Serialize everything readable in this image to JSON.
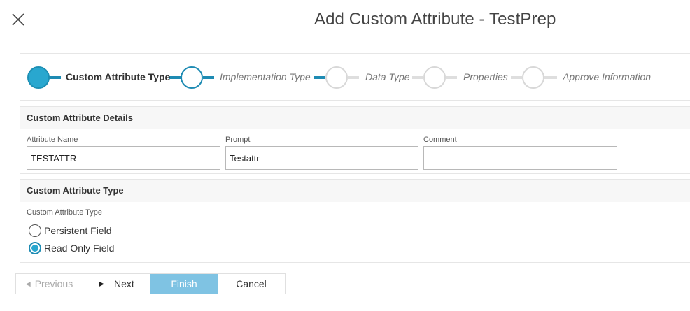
{
  "dialog": {
    "title": "Add Custom Attribute - TestPrep"
  },
  "wizard": {
    "steps": [
      {
        "label": "Custom Attribute Type",
        "state": "done"
      },
      {
        "label": "Implementation Type",
        "state": "active"
      },
      {
        "label": "Data Type",
        "state": "pending"
      },
      {
        "label": "Properties",
        "state": "pending"
      },
      {
        "label": "Approve Information",
        "state": "pending"
      }
    ]
  },
  "details": {
    "header": "Custom Attribute Details",
    "attribute_name": {
      "label": "Attribute Name",
      "value": "TESTATTR"
    },
    "prompt": {
      "label": "Prompt",
      "value": "Testattr"
    },
    "comment": {
      "label": "Comment",
      "value": ""
    }
  },
  "type_section": {
    "header": "Custom Attribute Type",
    "group_label": "Custom Attribute Type",
    "options": [
      {
        "label": "Persistent Field",
        "checked": false
      },
      {
        "label": "Read Only Field",
        "checked": true
      }
    ]
  },
  "footer": {
    "previous_label": "Previous",
    "next_label": "Next",
    "finish_label": "Finish",
    "cancel_label": "Cancel"
  },
  "colors": {
    "accent": "#1e8bb3",
    "accent_fill": "#29a7cf",
    "finish_bg": "#7fc3e3"
  },
  "icons": {
    "close": "close-icon",
    "previous": "triangle-left-icon",
    "next": "triangle-right-icon"
  }
}
